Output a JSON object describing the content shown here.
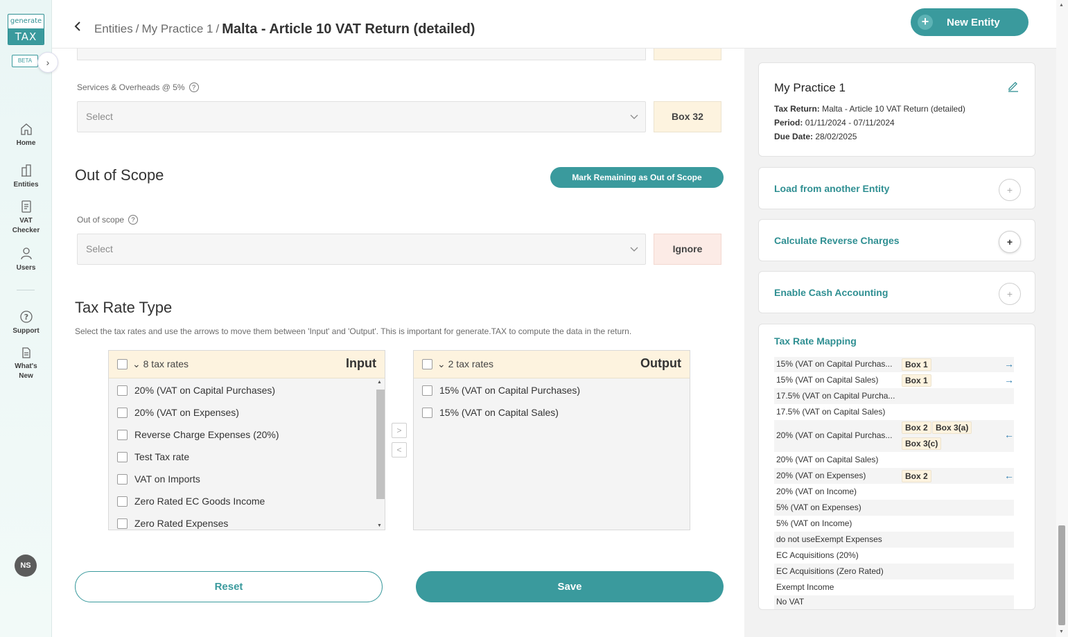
{
  "sidebar": {
    "logo_top": "generate",
    "logo_bottom": "TAX",
    "beta": "BETA",
    "items": [
      {
        "label": "Home"
      },
      {
        "label": "Entities"
      },
      {
        "label": "VAT Checker"
      },
      {
        "label": "Users"
      },
      {
        "label": "Support"
      },
      {
        "label": "What's New"
      }
    ],
    "avatar": "NS"
  },
  "header": {
    "breadcrumb": [
      "Entities",
      "My Practice 1"
    ],
    "separator": "/",
    "title": "Malta - Article 10 VAT Return (detailed)",
    "new_entity": "New Entity"
  },
  "main": {
    "services_label": "Services & Overheads @ 5%",
    "services_select": "Select",
    "services_box": "Box 32",
    "out_of_scope_title": "Out of Scope",
    "mark_remaining": "Mark Remaining as Out of Scope",
    "out_of_scope_label": "Out of scope",
    "out_of_scope_select": "Select",
    "out_of_scope_box": "Ignore",
    "tax_rate_title": "Tax Rate Type",
    "tax_rate_desc": "Select the tax rates and use the arrows to move them between 'Input' and 'Output'. This is important for generate.TAX to compute the data in the return.",
    "input": {
      "count": "8 tax rates",
      "side": "Input",
      "items": [
        "20% (VAT on Capital Purchases)",
        "20% (VAT on Expenses)",
        "Reverse Charge Expenses (20%)",
        "Test Tax rate",
        "VAT on Imports",
        "Zero Rated EC Goods Income",
        "Zero Rated Expenses"
      ]
    },
    "output": {
      "count": "2 tax rates",
      "side": "Output",
      "items": [
        "15% (VAT on Capital Purchases)",
        "15% (VAT on Capital Sales)"
      ]
    },
    "move_right": ">",
    "move_left": "<",
    "reset": "Reset",
    "save": "Save"
  },
  "right": {
    "entity_name": "My Practice 1",
    "tax_return_label": "Tax Return:",
    "tax_return_value": "Malta - Article 10 VAT Return (detailed)",
    "period_label": "Period:",
    "period_value": "01/11/2024 - 07/11/2024",
    "due_label": "Due Date:",
    "due_value": "28/02/2025",
    "load_entity": "Load from another Entity",
    "reverse_charges": "Calculate Reverse Charges",
    "cash_accounting": "Enable Cash Accounting",
    "mapping_title": "Tax Rate Mapping",
    "mapping": [
      {
        "name": "15% (VAT on Capital Purchas...",
        "boxes": [
          "Box 1"
        ],
        "arrow": "→"
      },
      {
        "name": "15% (VAT on Capital Sales)",
        "boxes": [
          "Box 1"
        ],
        "arrow": "→"
      },
      {
        "name": "17.5% (VAT on Capital Purcha...",
        "boxes": [],
        "arrow": ""
      },
      {
        "name": "17.5% (VAT on Capital Sales)",
        "boxes": [],
        "arrow": ""
      },
      {
        "name": "20% (VAT on Capital Purchas...",
        "boxes": [
          "Box 2",
          "Box 3(a)",
          "Box 3(c)"
        ],
        "arrow": "←"
      },
      {
        "name": "20% (VAT on Capital Sales)",
        "boxes": [],
        "arrow": ""
      },
      {
        "name": "20% (VAT on Expenses)",
        "boxes": [
          "Box 2"
        ],
        "arrow": "←"
      },
      {
        "name": "20% (VAT on Income)",
        "boxes": [],
        "arrow": ""
      },
      {
        "name": "5% (VAT on Expenses)",
        "boxes": [],
        "arrow": ""
      },
      {
        "name": "5% (VAT on Income)",
        "boxes": [],
        "arrow": ""
      },
      {
        "name": "do not useExempt Expenses",
        "boxes": [],
        "arrow": ""
      },
      {
        "name": "EC Acquisitions (20%)",
        "boxes": [],
        "arrow": ""
      },
      {
        "name": "EC Acquisitions (Zero Rated)",
        "boxes": [],
        "arrow": ""
      },
      {
        "name": "Exempt Income",
        "boxes": [],
        "arrow": ""
      },
      {
        "name": "No VAT",
        "boxes": [],
        "arrow": ""
      }
    ]
  },
  "colors": {
    "accent": "#3a9a9d",
    "box_bg": "#fdf3df",
    "ignore_bg": "#fcebe6",
    "link": "#2f8f92"
  }
}
